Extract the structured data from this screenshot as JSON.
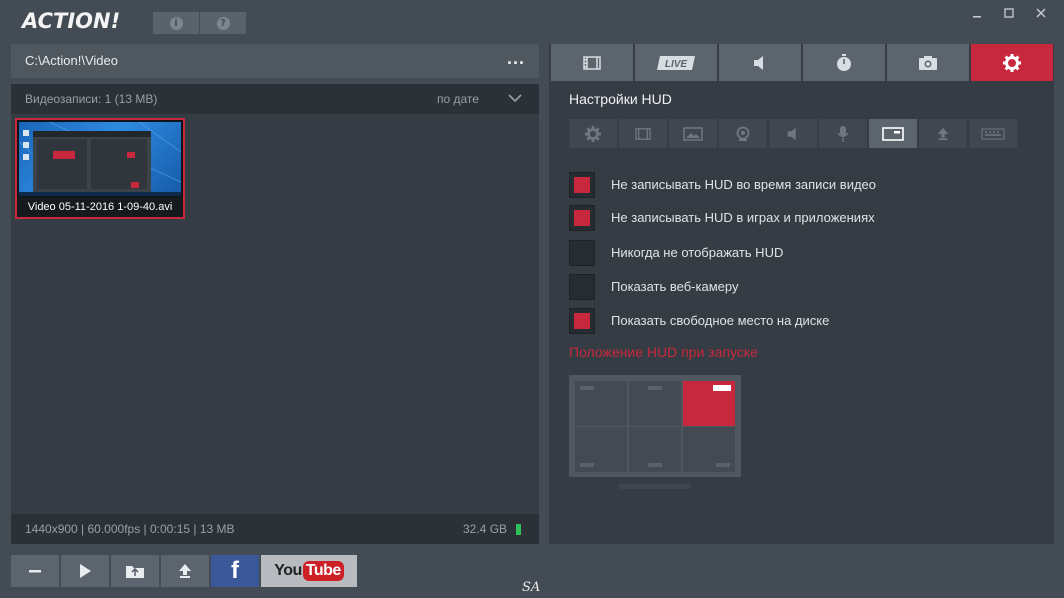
{
  "app": {
    "logo": "ACTION!"
  },
  "titlebar": {
    "info_label": "i",
    "help_label": "?",
    "window_controls": [
      "minimize-icon",
      "maximize-icon",
      "close-icon"
    ]
  },
  "left": {
    "path": "C:\\Action!\\Video",
    "path_menu": "...",
    "list_count": "Видеозаписи: 1 (13 MB)",
    "sort_label": "по дате",
    "items": [
      {
        "filename": "Video 05-11-2016 1-09-40.avi"
      }
    ],
    "footer_info": "1440x900 | 60.000fps | 0:00:15 | 13 MB",
    "disk_free": "32.4 GB"
  },
  "actions": {
    "buttons": [
      "minus-icon",
      "play-icon",
      "open-folder-icon",
      "upload-icon",
      "facebook-icon",
      "youtube-icon"
    ],
    "facebook_label": "f",
    "youtube_you": "You",
    "youtube_tube": "Tube"
  },
  "signature": "SA",
  "right": {
    "main_tabs": [
      {
        "icon": "film-icon"
      },
      {
        "icon": "live-icon",
        "label": "LIVE"
      },
      {
        "icon": "speaker-icon"
      },
      {
        "icon": "stopwatch-icon"
      },
      {
        "icon": "camera-icon"
      },
      {
        "icon": "gear-icon",
        "active": true
      }
    ],
    "title": "Настройки HUD",
    "sub_tabs": [
      "gear-icon",
      "film-icon",
      "image-icon",
      "webcam-icon",
      "speaker-icon",
      "microphone-icon",
      "hud-icon",
      "upload-icon",
      "keyboard-icon"
    ],
    "active_sub_tab": "hud-icon",
    "options": [
      {
        "label": "Не записывать HUD во время записи видео",
        "checked": true
      },
      {
        "label": "Не записывать HUD в играх и приложениях",
        "checked": true
      },
      {
        "label": "Никогда не отображать HUD",
        "checked": false
      },
      {
        "label": "Показать веб-камеру",
        "checked": false
      },
      {
        "label": "Показать свободное место на диске",
        "checked": true
      }
    ],
    "position_title": "Положение HUD при запуске",
    "position_selected": "top-right"
  },
  "colors": {
    "accent": "#c8283e",
    "background": "#434b54",
    "panel": "#353c43",
    "tab": "#5c656e"
  }
}
